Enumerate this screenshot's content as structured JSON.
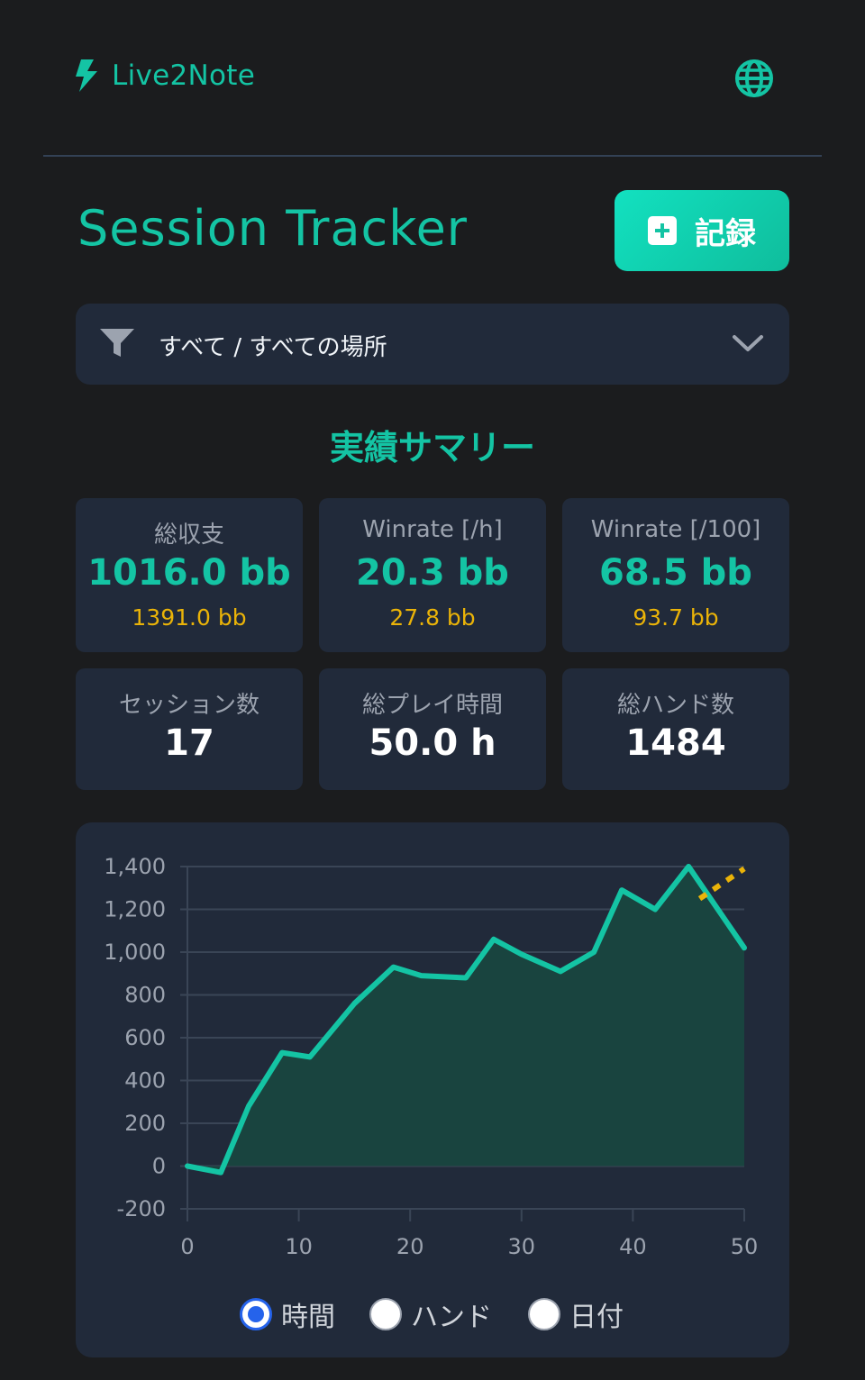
{
  "header": {
    "brand": "Live2Note",
    "icons": {
      "brand": "lightning-bolt-icon",
      "language": "globe-icon"
    }
  },
  "page": {
    "title": "Session Tracker"
  },
  "record_button": {
    "label": "記録",
    "icon": "plus-square-icon"
  },
  "filter": {
    "text": "すべて / すべての場所",
    "icon": "filter-icon",
    "toggle_icon": "chevron-down-icon"
  },
  "summary": {
    "title": "実績サマリー",
    "cards": [
      {
        "label": "総収支",
        "value": "1016.0 bb",
        "sub": "1391.0 bb"
      },
      {
        "label": "Winrate [/h]",
        "value": "20.3 bb",
        "sub": "27.8 bb"
      },
      {
        "label": "Winrate [/100]",
        "value": "68.5 bb",
        "sub": "93.7 bb"
      },
      {
        "label": "セッション数",
        "value": "17"
      },
      {
        "label": "総プレイ時間",
        "value": "50.0 h"
      },
      {
        "label": "総ハンド数",
        "value": "1484"
      }
    ]
  },
  "colors": {
    "accent": "#14c4a4",
    "secondary": "#eab308",
    "panel": "#212a3a",
    "background": "#1b1c1e"
  },
  "chart_data": {
    "type": "area",
    "xlim": [
      0,
      50
    ],
    "ylim": [
      -200,
      1400
    ],
    "x_ticks": [
      "0",
      "10",
      "20",
      "30",
      "40",
      "50"
    ],
    "y_ticks": [
      "1,400",
      "1,200",
      "1,000",
      "800",
      "600",
      "400",
      "200",
      "0",
      "-200"
    ],
    "grid": true,
    "series": [
      {
        "values": [
          [
            0,
            0
          ],
          [
            3,
            -30
          ],
          [
            5.5,
            280
          ],
          [
            8.5,
            530
          ],
          [
            11,
            510
          ],
          [
            15,
            760
          ],
          [
            18.5,
            930
          ],
          [
            21,
            890
          ],
          [
            25,
            880
          ],
          [
            27.5,
            1060
          ],
          [
            30,
            990
          ],
          [
            33.5,
            910
          ],
          [
            36.5,
            1000
          ],
          [
            39,
            1290
          ],
          [
            42,
            1200
          ],
          [
            45,
            1400
          ],
          [
            50,
            1020
          ]
        ]
      },
      {
        "values": [
          [
            46,
            1250
          ],
          [
            50,
            1390
          ]
        ]
      }
    ]
  },
  "x_axis_options": [
    {
      "label": "時間",
      "selected": true
    },
    {
      "label": "ハンド",
      "selected": false
    },
    {
      "label": "日付",
      "selected": false
    }
  ]
}
